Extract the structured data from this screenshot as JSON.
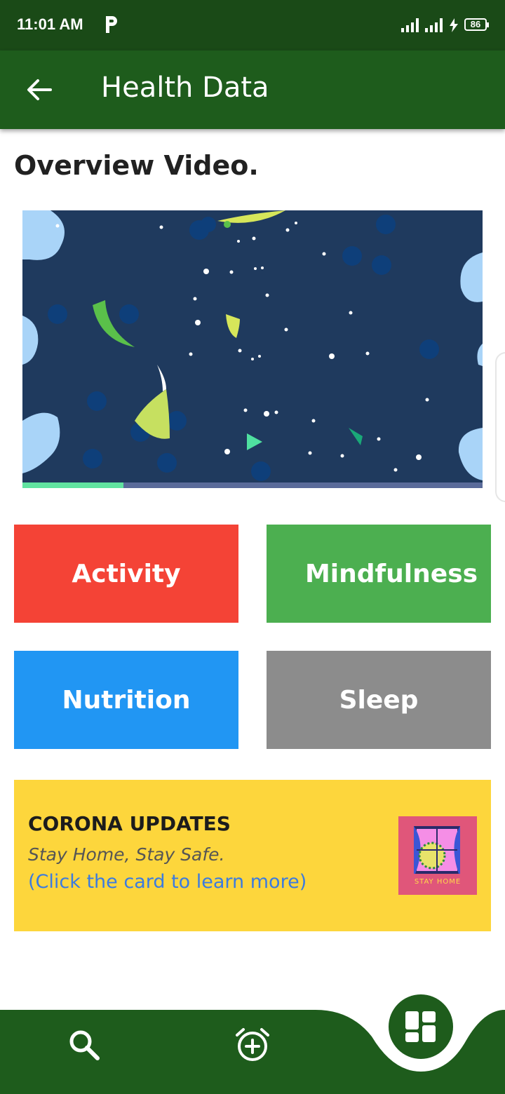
{
  "status_bar": {
    "time": "11:01 AM",
    "battery": "86",
    "icons": [
      "parking-app-icon",
      "signal-icon",
      "signal-icon",
      "charging-bolt-icon",
      "battery-icon"
    ]
  },
  "app_bar": {
    "title": "Health Data",
    "back_icon": "back-arrow-icon"
  },
  "overview": {
    "title": "Overview Video.",
    "video_progress": 0.22
  },
  "categories": [
    {
      "label": "Activity",
      "color": "#f44336"
    },
    {
      "label": "Mindfulness",
      "color": "#4caf50"
    },
    {
      "label": "Nutrition",
      "color": "#2196f3"
    },
    {
      "label": "Sleep",
      "color": "#8c8c8c"
    }
  ],
  "corona_card": {
    "title": "CORONA UPDATES",
    "subtitle": "Stay Home, Stay Safe.",
    "link_text": "(Click the card to learn more)",
    "thumbnail_caption": "STAY HOME",
    "background": "#fdd63c"
  },
  "bottom_nav": {
    "items": [
      "search-icon",
      "add-alarm-icon"
    ],
    "fab_icon": "dashboard-icon",
    "color": "#1e5c1c"
  }
}
